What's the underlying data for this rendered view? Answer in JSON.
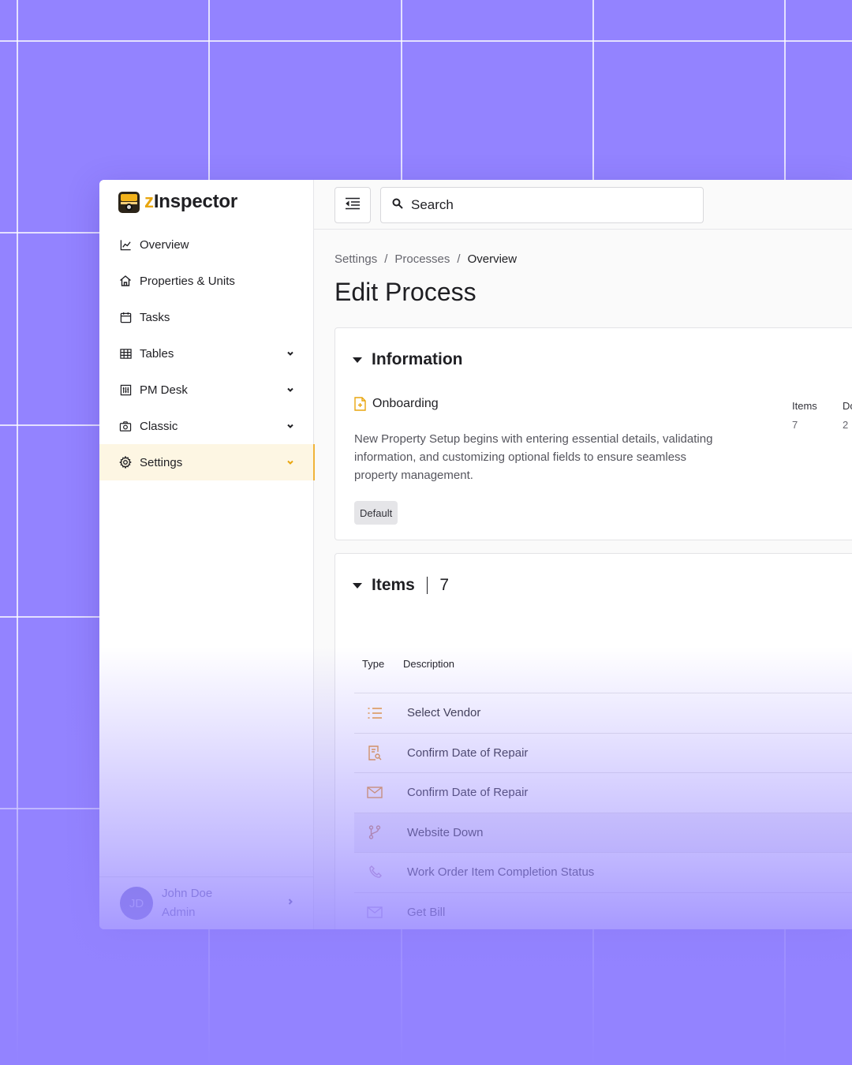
{
  "app": {
    "logo_prefix": "z",
    "logo_rest": "Inspector"
  },
  "sidebar": {
    "items": [
      {
        "label": "Overview",
        "icon": "chart-line-icon",
        "expandable": false,
        "active": false
      },
      {
        "label": "Properties & Units",
        "icon": "home-icon",
        "expandable": false,
        "active": false
      },
      {
        "label": "Tasks",
        "icon": "calendar-icon",
        "expandable": false,
        "active": false
      },
      {
        "label": "Tables",
        "icon": "table-icon",
        "expandable": true,
        "active": false
      },
      {
        "label": "PM Desk",
        "icon": "sliders-icon",
        "expandable": true,
        "active": false
      },
      {
        "label": "Classic",
        "icon": "camera-icon",
        "expandable": true,
        "active": false
      },
      {
        "label": "Settings",
        "icon": "gear-icon",
        "expandable": true,
        "active": true
      }
    ]
  },
  "user": {
    "initials": "JD",
    "name": "John Doe",
    "role": "Admin"
  },
  "search": {
    "placeholder": "Search"
  },
  "breadcrumb": {
    "items": [
      "Settings",
      "Processes"
    ],
    "current": "Overview",
    "separator": "/"
  },
  "page": {
    "title": "Edit Process"
  },
  "information": {
    "title": "Information",
    "process_name": "Onboarding",
    "description": "New Property Setup begins with entering essential details, validating information, and customizing optional fields to ensure seamless property management.",
    "badge": "Default",
    "stats": [
      {
        "label": "Items",
        "value": "7"
      },
      {
        "label": "Do",
        "value": "2"
      }
    ]
  },
  "items": {
    "title": "Items",
    "count": "7",
    "columns": [
      "Type",
      "Description"
    ],
    "rows": [
      {
        "icon": "list-icon",
        "description": "Select Vendor"
      },
      {
        "icon": "document-search-icon",
        "description": "Confirm Date of Repair"
      },
      {
        "icon": "mail-icon",
        "description": "Confirm Date of Repair"
      },
      {
        "icon": "branch-icon",
        "description": "Website Down"
      },
      {
        "icon": "phone-icon",
        "description": "Work Order Item Completion Status"
      },
      {
        "icon": "mail-icon",
        "description": "Get Bill"
      }
    ]
  },
  "colors": {
    "accent": "#E9A60F",
    "background": "#9383FF",
    "active_bg": "#FDF6E3"
  }
}
